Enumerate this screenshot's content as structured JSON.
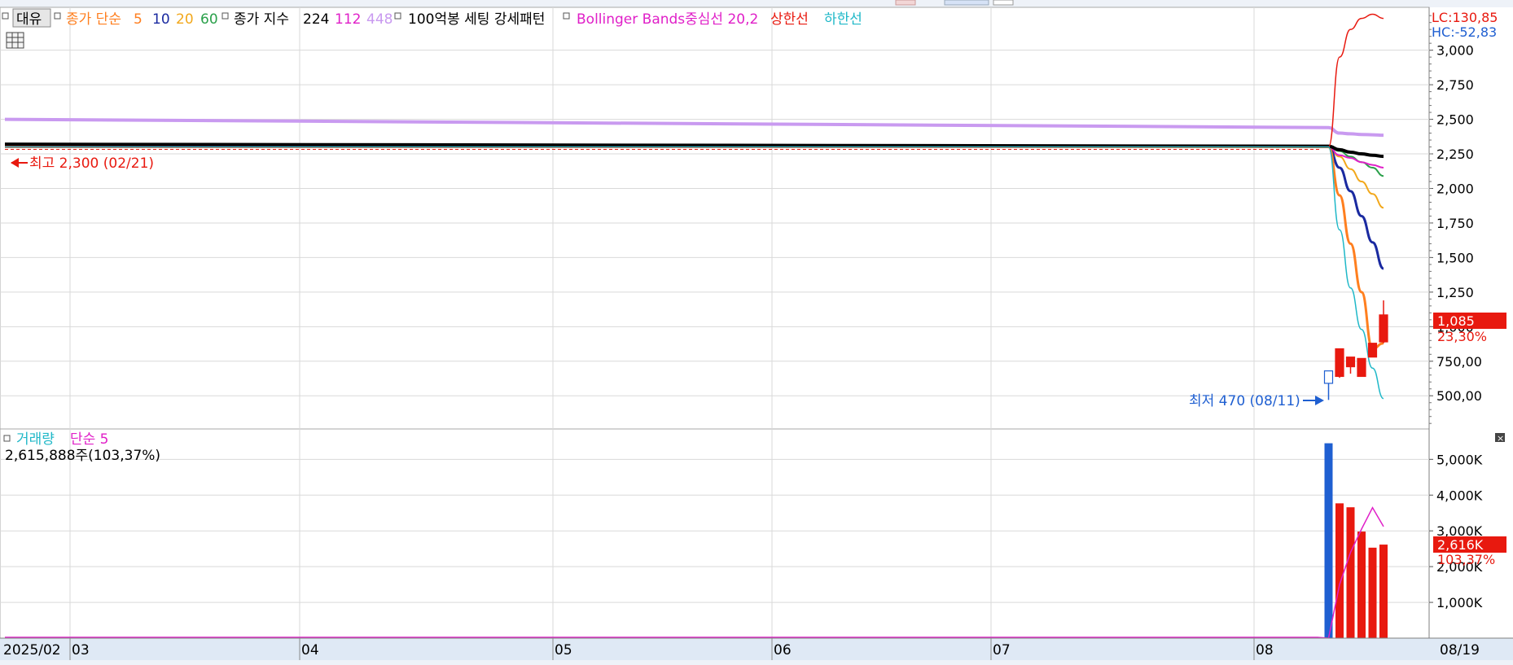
{
  "colors": {
    "up": "#e8190f",
    "down": "#1f5fd1",
    "ma5": "#ff7f1f",
    "ma10": "#1a2aa0",
    "ma20": "#f2a81c",
    "ma60": "#2aa04a",
    "idx224": "#000000",
    "idx112": "#e020c8",
    "idx448": "#c99af0",
    "bb_mid": "#e020c8",
    "bb_up": "#e8190f",
    "bb_low": "#1fb8c8",
    "vol_ma": "#e020c8",
    "grid": "#d9d9d9",
    "axis_bg": "#dfe9f5"
  },
  "price_legend": {
    "menu_label": "대유",
    "ma_label": "종가 단순",
    "ma_periods": [
      "5",
      "10",
      "20",
      "60"
    ],
    "index_label": "종가 지수",
    "index_periods": [
      "224",
      "112",
      "448"
    ],
    "pattern_label": "100억봉 세팅 강세패턴",
    "bb_label": "Bollinger Bands중심선 20,2",
    "bb_upper_label": "상한선",
    "bb_lower_label": "하한선"
  },
  "volume_legend": {
    "label": "거래량",
    "ma_label": "단순 5",
    "current": "2,615,888주(103,37%)"
  },
  "lc_label": "LC:130,85",
  "hc_label": "HC:-52,83",
  "high_marker": "최고 2,300 (02/21)",
  "low_marker": "최저 470 (08/11)",
  "price_tag": {
    "value": "1,085",
    "change": "23,30%"
  },
  "volume_tag": {
    "value": "2,616K",
    "change": "103,37%"
  },
  "close_glyph": "×",
  "chart_data": [
    {
      "type": "candlestick",
      "title": "",
      "y_tick_labels": [
        "500,00",
        "750,00",
        "1,000",
        "1,250",
        "1,500",
        "1,750",
        "2,000",
        "2,250",
        "2,500",
        "2,750",
        "3,000"
      ],
      "y_tick_values": [
        500,
        750,
        1000,
        1250,
        1500,
        1750,
        2000,
        2250,
        2500,
        2750,
        3000
      ],
      "ylim": [
        260,
        3310
      ],
      "x_tick_labels": [
        "2025/02",
        "03",
        "04",
        "05",
        "06",
        "07",
        "08",
        "08/19"
      ],
      "candles": [
        {
          "open": 2300,
          "high": 2300,
          "low": 2300,
          "close": 2300
        },
        {
          "open": 590,
          "high": 680,
          "low": 470,
          "close": 680
        },
        {
          "open": 640,
          "high": 840,
          "low": 630,
          "close": 840
        },
        {
          "open": 780,
          "high": 780,
          "low": 660,
          "close": 710
        },
        {
          "open": 640,
          "high": 760,
          "low": 640,
          "close": 770
        },
        {
          "open": 780,
          "high": 860,
          "low": 780,
          "close": 880
        },
        {
          "open": 890,
          "high": 1190,
          "low": 880,
          "close": 1085
        }
      ],
      "series": [
        {
          "name": "종가 단순 5",
          "values": [
            2300,
            2300,
            1950,
            1600,
            1250,
            840,
            880
          ]
        },
        {
          "name": "종가 단순 10",
          "values": [
            2300,
            2300,
            2150,
            1980,
            1800,
            1610,
            1420
          ]
        },
        {
          "name": "종가 단순 20",
          "values": [
            2300,
            2300,
            2230,
            2140,
            2050,
            1960,
            1860
          ]
        },
        {
          "name": "종가 단순 60",
          "values": [
            2300,
            2300,
            2270,
            2230,
            2190,
            2150,
            2090
          ]
        },
        {
          "name": "종가 지수 224",
          "values": [
            2320,
            2305,
            2280,
            2262,
            2250,
            2240,
            2232
          ]
        },
        {
          "name": "종가 지수 112",
          "values": [
            2300,
            2300,
            2240,
            2220,
            2190,
            2170,
            2150
          ]
        },
        {
          "name": "종가 지수 448",
          "values": [
            2500,
            2440,
            2400,
            2395,
            2390,
            2388,
            2385
          ]
        },
        {
          "name": "상한선",
          "values": [
            2300,
            2300,
            2950,
            3150,
            3230,
            3260,
            3230
          ]
        },
        {
          "name": "하한선",
          "values": [
            2300,
            2300,
            1700,
            1280,
            980,
            700,
            480
          ]
        }
      ]
    },
    {
      "type": "bar",
      "title": "",
      "y_tick_labels": [
        "1,000K",
        "2,000K",
        "3,000K",
        "4,000K",
        "5,000K"
      ],
      "y_tick_values": [
        1000,
        2000,
        3000,
        4000,
        5000
      ],
      "ylim": [
        0,
        5850
      ],
      "unit": "K",
      "values": [
        0,
        5450,
        3770,
        3660,
        2980,
        2530,
        2616
      ],
      "ma5_values": [
        0,
        0,
        1500,
        2400,
        3050,
        3650,
        3120
      ]
    }
  ]
}
